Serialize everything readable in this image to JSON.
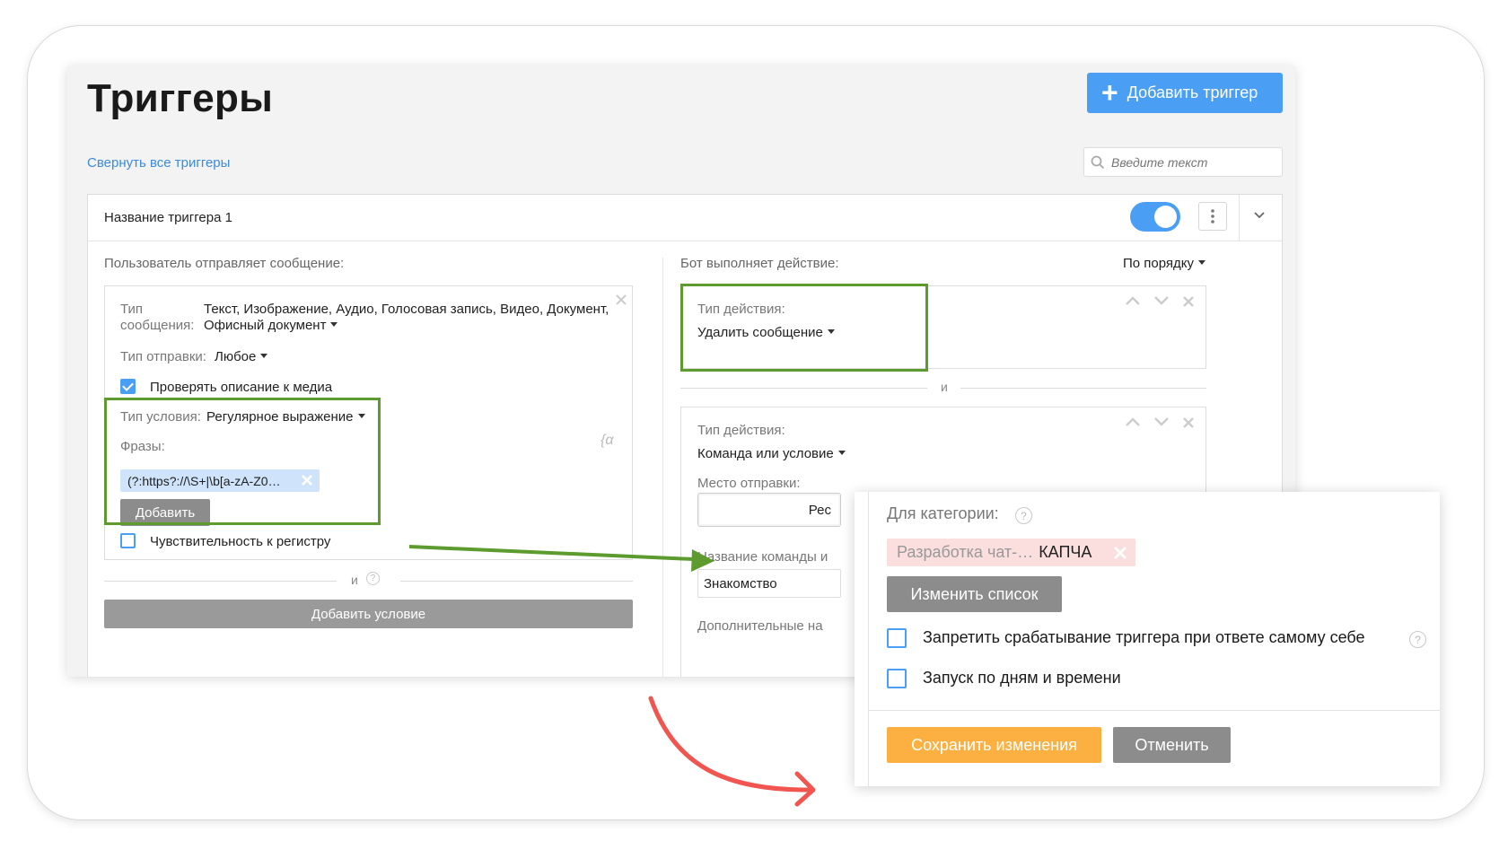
{
  "header": {
    "title": "Триггеры",
    "add_trigger_label": "Добавить триггер",
    "collapse_all_label": "Свернуть все триггеры",
    "search_placeholder": "Введите текст"
  },
  "trigger": {
    "name": "Название триггера 1",
    "enabled": true,
    "left": {
      "section_label": "Пользователь отправляет сообщение:",
      "message_type_label_1": "Тип",
      "message_type_label_2": "сообщения:",
      "message_type_value_1": "Текст, Изображение, Аудио, Голосовая запись, Видео, Документ,",
      "message_type_value_2": "Офисный документ",
      "send_type_label": "Тип отправки:",
      "send_type_value": "Любое",
      "check_media_label": "Проверять описание к медиа",
      "check_media_checked": true,
      "condition_type_label": "Тип условия:",
      "condition_type_value": "Регулярное выражение",
      "phrases_label": "Фразы:",
      "phrase_chip": "(?:https?://\\S+|\\b[a-zA-Z0…",
      "add_phrase_label": "Добавить",
      "case_sensitive_label": "Чувствительность к регистру",
      "case_sensitive_checked": false,
      "and_label": "и",
      "add_condition_label": "Добавить условие"
    },
    "right": {
      "section_label": "Бот выполняет действие:",
      "order_label": "По порядку",
      "action1": {
        "type_label": "Тип действия:",
        "type_value": "Удалить сообщение"
      },
      "and_label": "и",
      "action2": {
        "type_label": "Тип действия:",
        "type_value": "Команда или условие",
        "place_label": "Место отправки:",
        "place_value": "Рес",
        "cmd_name_label": "Название команды и",
        "cmd_name_value": "Знакомство",
        "extra_label": "Дополнительные на"
      }
    }
  },
  "popup": {
    "category_label": "Для категории:",
    "category_chip_muted": "Разработка чат-…",
    "category_chip_strong": "КАПЧА",
    "change_list_label": "Изменить список",
    "forbid_self_label": "Запретить срабатывание триггера при ответе самому себе",
    "schedule_label": "Запуск по дням и времени",
    "save_label": "Сохранить изменения",
    "cancel_label": "Отменить"
  },
  "colors": {
    "accent": "#4a9ff5",
    "highlight": "#5d9b2f",
    "save": "#fbb041",
    "arrow": "#f0554f"
  }
}
